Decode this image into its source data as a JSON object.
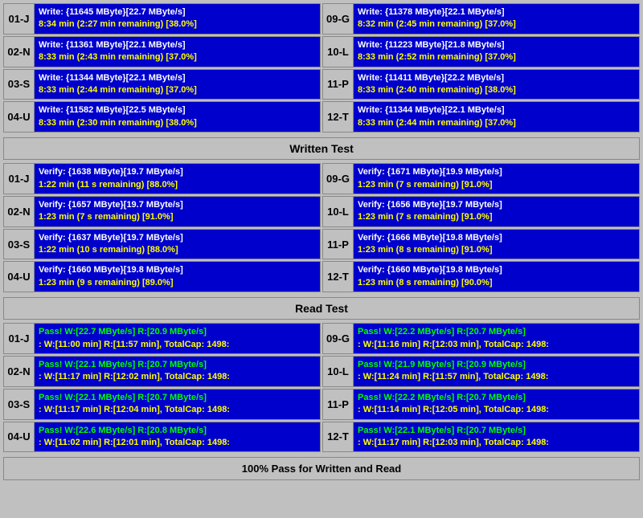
{
  "sections": {
    "write": {
      "rows": [
        {
          "left": {
            "label": "01-J",
            "line1": "Write: {11645 MByte}[22.7 MByte/s]",
            "line2": "8:34 min (2:27 min remaining)  [38.0%]"
          },
          "right": {
            "label": "09-G",
            "line1": "Write: {11378 MByte}[22.1 MByte/s]",
            "line2": "8:32 min (2:45 min remaining)  [37.0%]"
          }
        },
        {
          "left": {
            "label": "02-N",
            "line1": "Write: {11361 MByte}[22.1 MByte/s]",
            "line2": "8:33 min (2:43 min remaining)  [37.0%]"
          },
          "right": {
            "label": "10-L",
            "line1": "Write: {11223 MByte}[21.8 MByte/s]",
            "line2": "8:33 min (2:52 min remaining)  [37.0%]"
          }
        },
        {
          "left": {
            "label": "03-S",
            "line1": "Write: {11344 MByte}[22.1 MByte/s]",
            "line2": "8:33 min (2:44 min remaining)  [37.0%]"
          },
          "right": {
            "label": "11-P",
            "line1": "Write: {11411 MByte}[22.2 MByte/s]",
            "line2": "8:33 min (2:40 min remaining)  [38.0%]"
          }
        },
        {
          "left": {
            "label": "04-U",
            "line1": "Write: {11582 MByte}[22.5 MByte/s]",
            "line2": "8:33 min (2:30 min remaining)  [38.0%]"
          },
          "right": {
            "label": "12-T",
            "line1": "Write: {11344 MByte}[22.1 MByte/s]",
            "line2": "8:33 min (2:44 min remaining)  [37.0%]"
          }
        }
      ],
      "header": "Written Test"
    },
    "verify": {
      "rows": [
        {
          "left": {
            "label": "01-J",
            "line1": "Verify: {1638 MByte}[19.7 MByte/s]",
            "line2": "1:22 min (11 s remaining)   [88.0%]"
          },
          "right": {
            "label": "09-G",
            "line1": "Verify: {1671 MByte}[19.9 MByte/s]",
            "line2": "1:23 min (7 s remaining)   [91.0%]"
          }
        },
        {
          "left": {
            "label": "02-N",
            "line1": "Verify: {1657 MByte}[19.7 MByte/s]",
            "line2": "1:23 min (7 s remaining)   [91.0%]"
          },
          "right": {
            "label": "10-L",
            "line1": "Verify: {1656 MByte}[19.7 MByte/s]",
            "line2": "1:23 min (7 s remaining)   [91.0%]"
          }
        },
        {
          "left": {
            "label": "03-S",
            "line1": "Verify: {1637 MByte}[19.7 MByte/s]",
            "line2": "1:22 min (10 s remaining)   [88.0%]"
          },
          "right": {
            "label": "11-P",
            "line1": "Verify: {1666 MByte}[19.8 MByte/s]",
            "line2": "1:23 min (8 s remaining)   [91.0%]"
          }
        },
        {
          "left": {
            "label": "04-U",
            "line1": "Verify: {1660 MByte}[19.8 MByte/s]",
            "line2": "1:23 min (9 s remaining)   [89.0%]"
          },
          "right": {
            "label": "12-T",
            "line1": "Verify: {1660 MByte}[19.8 MByte/s]",
            "line2": "1:23 min (8 s remaining)   [90.0%]"
          }
        }
      ],
      "header": "Read Test"
    },
    "pass": {
      "rows": [
        {
          "left": {
            "label": "01-J",
            "line1": "Pass! W:[22.7 MByte/s] R:[20.9 MByte/s]",
            "line2": ": W:[11:00 min] R:[11:57 min], TotalCap: 1498:"
          },
          "right": {
            "label": "09-G",
            "line1": "Pass! W:[22.2 MByte/s] R:[20.7 MByte/s]",
            "line2": ": W:[11:16 min] R:[12:03 min], TotalCap: 1498:"
          }
        },
        {
          "left": {
            "label": "02-N",
            "line1": "Pass! W:[22.1 MByte/s] R:[20.7 MByte/s]",
            "line2": ": W:[11:17 min] R:[12:02 min], TotalCap: 1498:"
          },
          "right": {
            "label": "10-L",
            "line1": "Pass! W:[21.9 MByte/s] R:[20.9 MByte/s]",
            "line2": ": W:[11:24 min] R:[11:57 min], TotalCap: 1498:"
          }
        },
        {
          "left": {
            "label": "03-S",
            "line1": "Pass! W:[22.1 MByte/s] R:[20.7 MByte/s]",
            "line2": ": W:[11:17 min] R:[12:04 min], TotalCap: 1498:"
          },
          "right": {
            "label": "11-P",
            "line1": "Pass! W:[22.2 MByte/s] R:[20.7 MByte/s]",
            "line2": ": W:[11:14 min] R:[12:05 min], TotalCap: 1498:"
          }
        },
        {
          "left": {
            "label": "04-U",
            "line1": "Pass! W:[22.6 MByte/s] R:[20.8 MByte/s]",
            "line2": ": W:[11:02 min] R:[12:01 min], TotalCap: 1498:"
          },
          "right": {
            "label": "12-T",
            "line1": "Pass! W:[22.1 MByte/s] R:[20.7 MByte/s]",
            "line2": ": W:[11:17 min] R:[12:03 min], TotalCap: 1498:"
          }
        }
      ],
      "header": "Read Test"
    }
  },
  "footer": "100% Pass for Written and Read"
}
